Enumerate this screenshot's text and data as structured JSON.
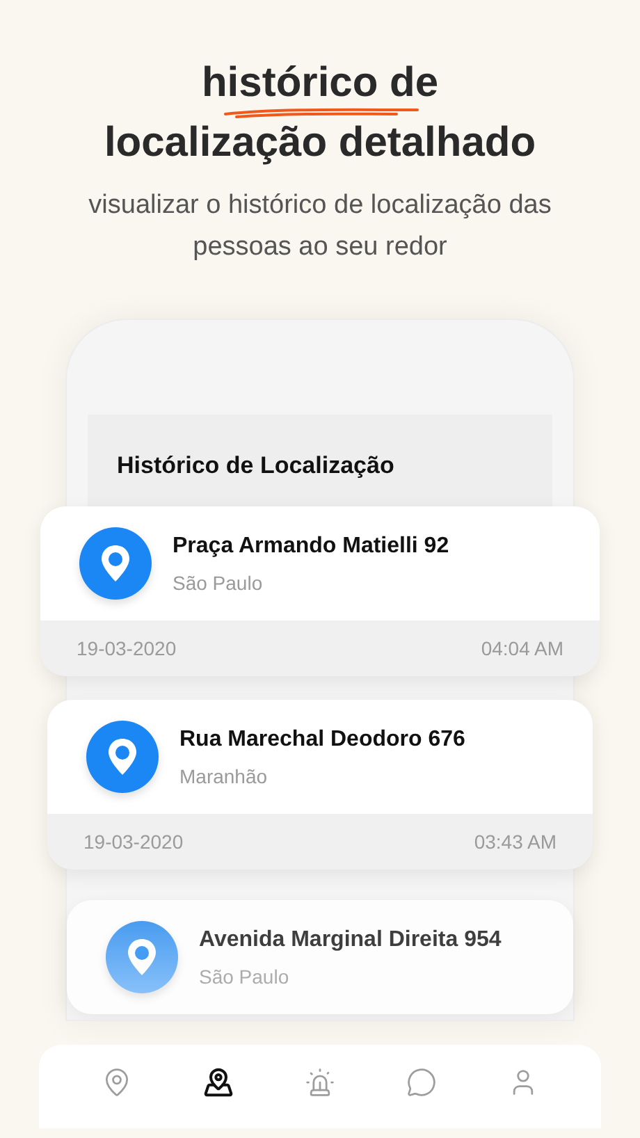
{
  "headline": {
    "line_1": "histórico de",
    "line_2": "localização detalhado"
  },
  "subtitle": "visualizar o histórico de localização das pessoas ao seu redor",
  "screen": {
    "title": "Histórico de Localização",
    "entries": [
      {
        "address": "Praça Armando Matielli 92",
        "region": "São Paulo",
        "date": "19-03-2020",
        "time": "04:04 AM"
      },
      {
        "address": "Rua Marechal Deodoro 676",
        "region": "Maranhão",
        "date": "19-03-2020",
        "time": "03:43 AM"
      },
      {
        "address": "Avenida Marginal Direita 954",
        "region": "São Paulo"
      }
    ]
  },
  "nav": [
    {
      "kind": "location",
      "selected": false
    },
    {
      "kind": "map",
      "selected": true
    },
    {
      "kind": "alarm",
      "selected": false
    },
    {
      "kind": "chat",
      "selected": false
    },
    {
      "kind": "profile",
      "selected": false
    }
  ]
}
